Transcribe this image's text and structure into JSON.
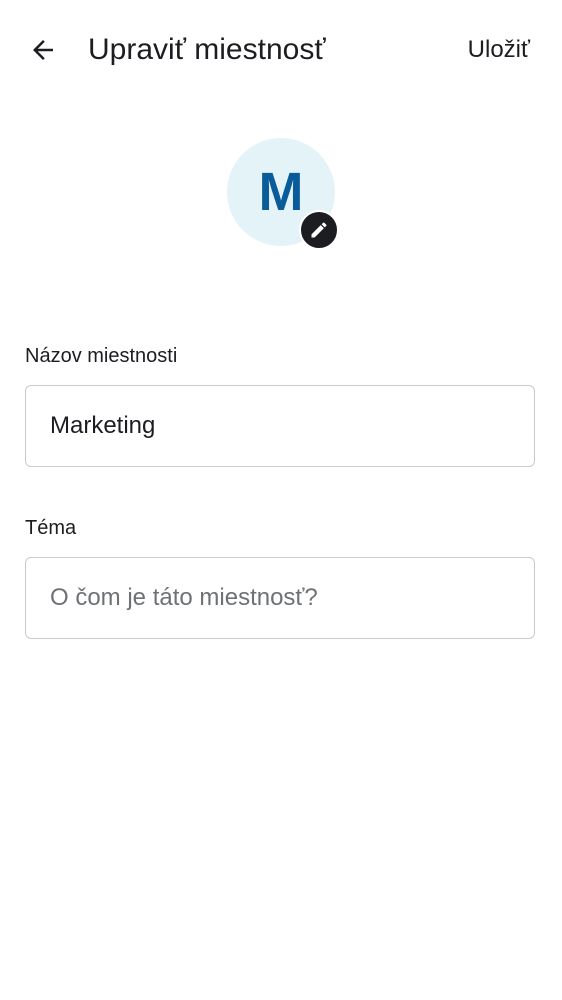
{
  "header": {
    "title": "Upraviť miestnosť",
    "save_label": "Uložiť",
    "back_icon": "arrow-left-icon"
  },
  "avatar": {
    "initial": "M",
    "background_color": "#e3f3f8",
    "initial_color": "#0a5b9a",
    "edit_icon": "pencil-icon"
  },
  "form": {
    "name": {
      "label": "Názov miestnosti",
      "value": "Marketing",
      "placeholder": ""
    },
    "topic": {
      "label": "Téma",
      "value": "",
      "placeholder": "O čom je táto miestnosť?"
    }
  }
}
